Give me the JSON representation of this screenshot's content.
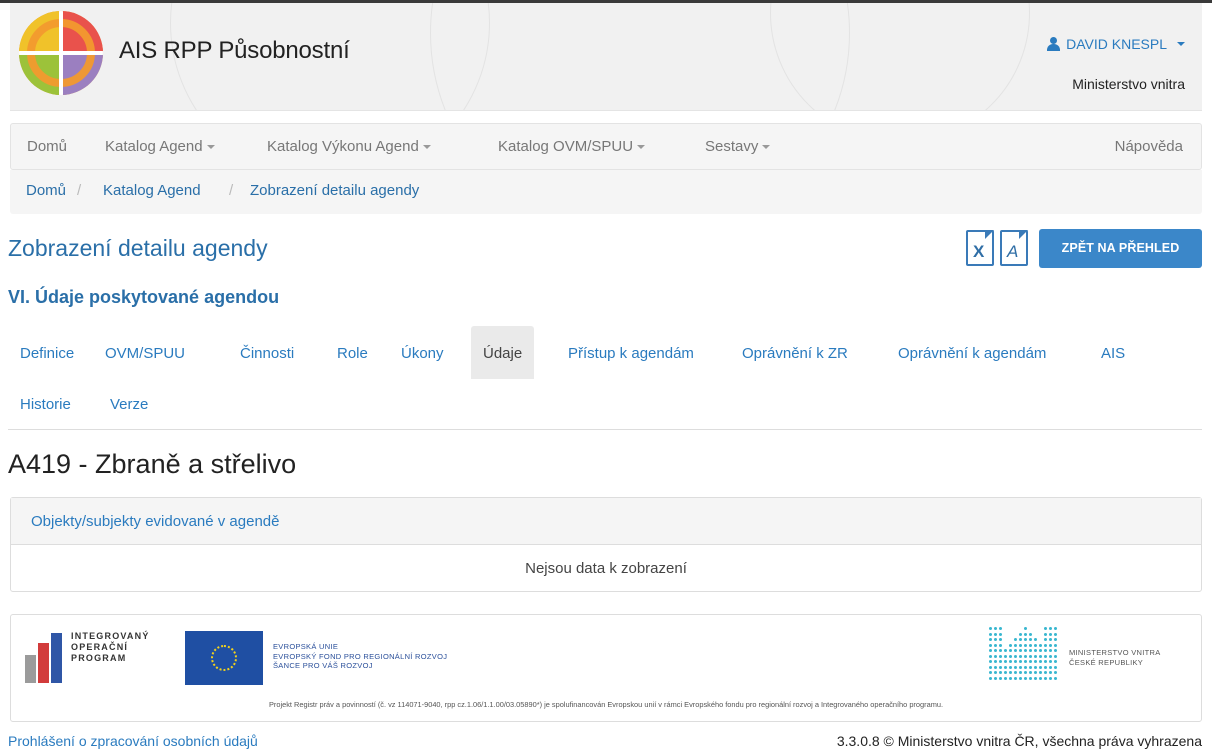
{
  "header": {
    "app_title": "AIS RPP Působnostní",
    "user_name": "DAVID KNESPL",
    "organization": "Ministerstvo vnitra"
  },
  "navbar": {
    "items": [
      {
        "label": "Domů"
      },
      {
        "label": "Katalog Agend"
      },
      {
        "label": "Katalog Výkonu Agend"
      },
      {
        "label": "Katalog OVM/SPUU"
      },
      {
        "label": "Sestavy"
      }
    ],
    "help": "Nápověda"
  },
  "breadcrumb": {
    "items": [
      "Domů",
      "Katalog Agend",
      "Zobrazení detailu agendy"
    ],
    "separator": "/"
  },
  "page": {
    "title": "Zobrazení detailu agendy",
    "back_button": "ZPĚT NA PŘEHLED",
    "section_title": "VI. Údaje poskytované agendou",
    "record_title": "A419 - Zbraně a střelivo"
  },
  "export": {
    "excel_icon": "excel-file-icon",
    "excel_glyph": "X",
    "pdf_icon": "pdf-file-icon",
    "pdf_glyph": "A"
  },
  "tabs": [
    {
      "label": "Definice"
    },
    {
      "label": "OVM/SPUU"
    },
    {
      "label": "Činnosti"
    },
    {
      "label": "Role"
    },
    {
      "label": "Úkony"
    },
    {
      "label": "Údaje",
      "active": true
    },
    {
      "label": "Přístup k agendám"
    },
    {
      "label": "Oprávnění k ZR"
    },
    {
      "label": "Oprávnění k agendám"
    },
    {
      "label": "AIS"
    },
    {
      "label": "Historie"
    },
    {
      "label": "Verze"
    }
  ],
  "panel": {
    "heading": "Objekty/subjekty evidované v agendě",
    "empty_text": "Nejsou data k zobrazení"
  },
  "logos": {
    "iop_lines": [
      "INTEGROVANÝ",
      "OPERAČNÍ",
      "PROGRAM"
    ],
    "eu_lines": [
      "EVROPSKÁ UNIE",
      "EVROPSKÝ FOND PRO REGIONÁLNÍ ROZVOJ",
      "ŠANCE PRO VÁŠ ROZVOJ"
    ],
    "mv_lines": [
      "MINISTERSTVO VNITRA",
      "ČESKÉ REPUBLIKY"
    ],
    "project_note": "Projekt Registr práv a povinností (č. vz 114071-9040, rpp cz.1.06/1.1.00/03.05890*) je spolufinancován Evropskou unií v rámci Evropského fondu pro regionální rozvoj a Integrovaného operačního programu."
  },
  "footer": {
    "privacy_link": "Prohlášení o zpracování osobních údajů",
    "copyright": "3.3.0.8 © Ministerstvo vnitra ČR, všechna práva vyhrazena"
  },
  "colors": {
    "link": "#2a7bbf",
    "primary_button": "#3b87c9",
    "logo_orange": "#f29a2e",
    "eu_blue": "#1f4fa3",
    "mv_cyan": "#39b7d0"
  }
}
